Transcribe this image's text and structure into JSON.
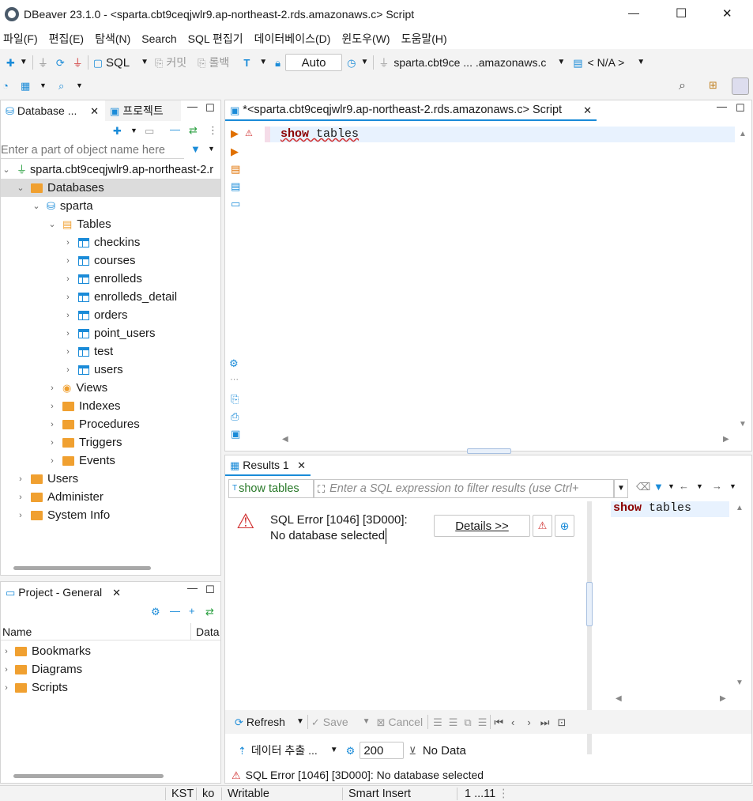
{
  "window": {
    "title": "DBeaver 23.1.0 - <sparta.cbt9ceqjwlr9.ap-northeast-2.rds.amazonaws.c> Script",
    "minimize_glyph": "—",
    "maximize_glyph": "☐",
    "close_glyph": "✕"
  },
  "menu": [
    "파일(F)",
    "편집(E)",
    "탐색(N)",
    "Search",
    "SQL 편집기",
    "데이터베이스(D)",
    "윈도우(W)",
    "도움말(H)"
  ],
  "toolbar": {
    "sql_label": "SQL",
    "commit_label": "커밋",
    "rollback_label": "롤백",
    "transaction_mode": "Auto",
    "connection_label": "sparta.cbt9ce ... .amazonaws.c",
    "schema_label": "< N/A >"
  },
  "navigator": {
    "tab_db": "Database ...",
    "tab_project": "프로젝트",
    "filter_placeholder": "Enter a part of object name here",
    "connection": "sparta.cbt9ceqjwlr9.ap-northeast-2.r",
    "databases": "Databases",
    "schema": "sparta",
    "tables_folder": "Tables",
    "tables": [
      "checkins",
      "courses",
      "enrolleds",
      "enrolleds_detail",
      "orders",
      "point_users",
      "test",
      "users"
    ],
    "folders": [
      "Views",
      "Indexes",
      "Procedures",
      "Triggers",
      "Events"
    ],
    "root_items": [
      "Users",
      "Administer",
      "System Info"
    ]
  },
  "project": {
    "tab_label": "Project - General",
    "col_name": "Name",
    "col_data": "Data",
    "items": [
      "Bookmarks",
      "Diagrams",
      "Scripts"
    ]
  },
  "editor": {
    "tab_label": "*<sparta.cbt9ceqjwlr9.ap-northeast-2.rds.amazonaws.c> Script",
    "keyword": "show",
    "rest": " tables"
  },
  "results": {
    "tab_label": "Results 1",
    "query_label": "show tables",
    "filter_placeholder": "Enter a SQL expression to filter results (use Ctrl+",
    "error_line1": "SQL Error [1046] [3D000]:",
    "error_line2": "No database selected",
    "details_button": "Details >>",
    "side_keyword": "show",
    "side_rest": " tables",
    "refresh": "Refresh",
    "save": "Save",
    "cancel": "Cancel",
    "export_label": "데이터 추출 ...",
    "fetch_size": "200",
    "no_data": "No Data",
    "status_error": "SQL Error [1046] [3D000]: No database selected"
  },
  "statusbar": {
    "timezone": "KST",
    "locale": "ko",
    "mode": "Writable",
    "insert": "Smart Insert",
    "position": "1 ...11"
  },
  "colors": {
    "accent": "#1a8bd8",
    "folder": "#f0a030",
    "error": "#d03030",
    "keyword": "#8b0000"
  }
}
